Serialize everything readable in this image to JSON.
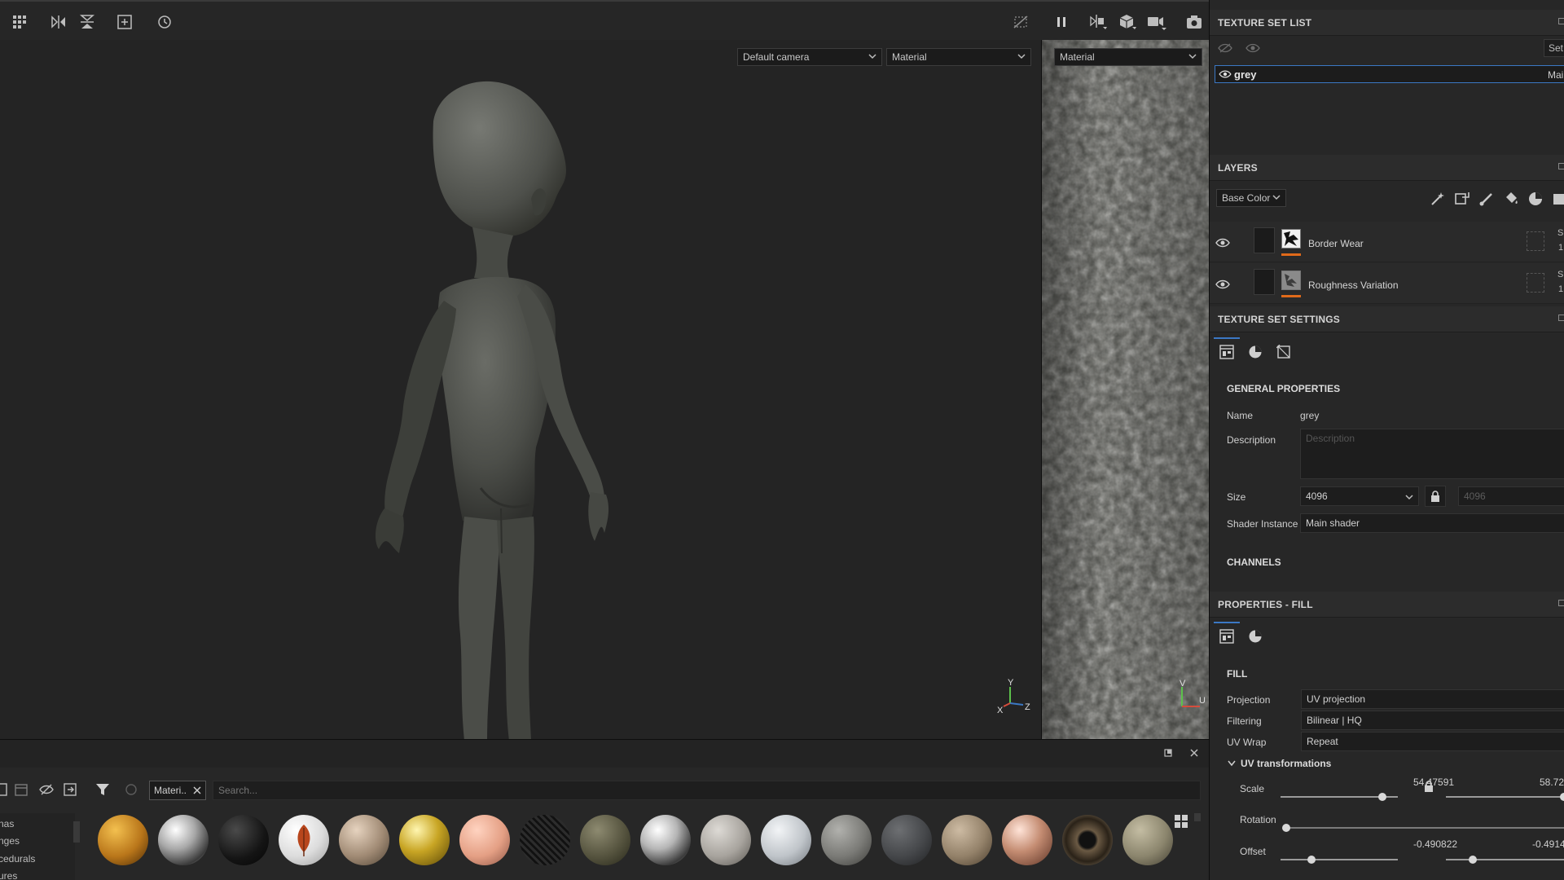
{
  "viewport": {
    "camera_select": "Default camera",
    "mode_select_3d": "Material",
    "mode_select_2d": "Material",
    "axis_3d": {
      "y": "Y",
      "x": "X",
      "z": "Z"
    },
    "axis_2d": {
      "v": "V",
      "u": "U"
    }
  },
  "texture_set_list": {
    "title": "TEXTURE SET LIST",
    "settings_btn": "Set",
    "item": {
      "name": "grey",
      "shader": "Main"
    }
  },
  "layers": {
    "title": "LAYERS",
    "channel_select": "Base Color",
    "items": [
      {
        "name": "Border Wear",
        "blend": "S",
        "opacity": "1"
      },
      {
        "name": "Roughness Variation",
        "blend": "S",
        "opacity": "1"
      }
    ]
  },
  "texture_set_settings": {
    "title": "TEXTURE SET SETTINGS",
    "general_title": "GENERAL PROPERTIES",
    "name_label": "Name",
    "name_value": "grey",
    "description_label": "Description",
    "description_placeholder": "Description",
    "size_label": "Size",
    "size_value": "4096",
    "size_value_locked": "4096",
    "shader_label": "Shader Instance",
    "shader_value": "Main shader",
    "channels_title": "CHANNELS"
  },
  "properties_fill": {
    "title": "PROPERTIES - FILL",
    "fill_title": "FILL",
    "projection_label": "Projection",
    "projection_value": "UV projection",
    "filtering_label": "Filtering",
    "filtering_value": "Bilinear | HQ",
    "uvwrap_label": "UV Wrap",
    "uvwrap_value": "Repeat",
    "uvtrans_title": "UV transformations",
    "scale_label": "Scale",
    "scale_value_1": "54.47591",
    "scale_value_2": "58.72",
    "rotation_label": "Rotation",
    "offset_label": "Offset",
    "offset_value_1": "-0.490822",
    "offset_value_2": "-0.4914"
  },
  "shelf": {
    "filter_tag": "Materi..",
    "search_placeholder": "Search...",
    "categories": [
      "nas",
      "nges",
      "cedurals",
      "ures"
    ]
  },
  "colors": {
    "accent_blue": "#3b78c4",
    "layer_orange": "#e06a1a",
    "panel_bg": "#272727",
    "viewport_bg": "#242424"
  }
}
